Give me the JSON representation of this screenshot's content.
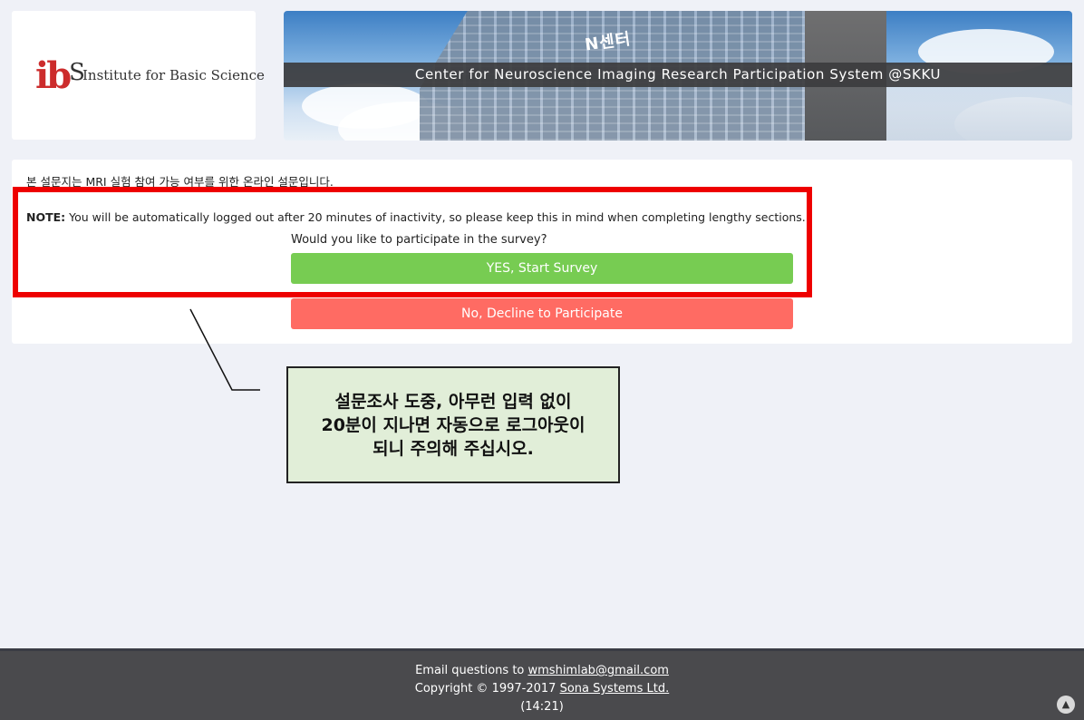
{
  "header": {
    "logo_mark": "ibS",
    "logo_text": "Institute for Basic Science",
    "banner_sign": "N센터",
    "banner_title": "Center for Neuroscience Imaging Research Participation System @SKKU"
  },
  "survey": {
    "intro": "본 설문지는 MRI 실험 참여 가능 여부를 위한 온라인 설문입니다.",
    "note_label": "NOTE:",
    "note_text": " You will be automatically logged out after 20 minutes of inactivity, so please keep this in mind when completing lengthy sections.",
    "question": "Would you like to participate in the survey?",
    "yes_button": "YES, Start Survey",
    "no_button": "No, Decline to Participate"
  },
  "annotation": {
    "callout": "설문조사 도중, 아무런 입력 없이\n20분이 지나면 자동으로 로그아웃이\n되니 주의해 주십시오.",
    "highlight_color": "#ee0000",
    "callout_bg": "#e1eed8"
  },
  "footer": {
    "email_prefix": "Email questions to ",
    "email": "wmshimlab@gmail.com",
    "copyright_prefix": "Copyright © 1997-2017 ",
    "company": "Sona Systems Ltd.",
    "time": "(14:21)",
    "scroll_top_icon": "chevron-up-icon"
  },
  "colors": {
    "yes": "#77cc52",
    "no": "#ff6b63",
    "footer": "#4a4a4d",
    "page_bg": "#eff1f7"
  }
}
